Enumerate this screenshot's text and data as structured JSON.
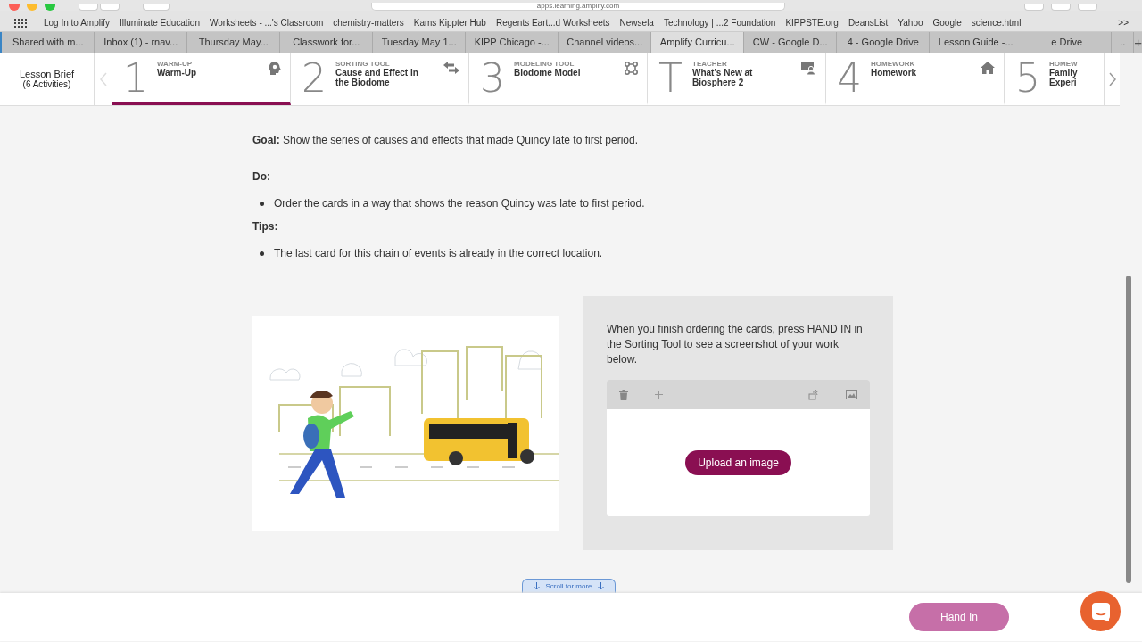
{
  "browser": {
    "address": "apps.learning.amplify.com",
    "bookmarks": [
      "Log In to Amplify",
      "Illuminate Education",
      "Worksheets - ...'s Classroom",
      "chemistry-matters",
      "Kams Kippter Hub",
      "Regents Eart...d Worksheets",
      "Newsela",
      "Technology | ...2 Foundation",
      "KIPPSTE.org",
      "DeansList",
      "Yahoo",
      "Google",
      "science.html"
    ],
    "bookmarks_more": ">>",
    "tabs": [
      {
        "label": "Shared with m...",
        "selected": false
      },
      {
        "label": "Inbox (1) - rnav...",
        "selected": false
      },
      {
        "label": "Thursday May...",
        "selected": false
      },
      {
        "label": "Classwork for...",
        "selected": false
      },
      {
        "label": "Tuesday May 1...",
        "selected": false
      },
      {
        "label": "KIPP Chicago -...",
        "selected": false
      },
      {
        "label": "Channel videos...",
        "selected": false
      },
      {
        "label": "Amplify Curricu...",
        "selected": true
      },
      {
        "label": "CW - Google D...",
        "selected": false
      },
      {
        "label": "4 - Google Drive",
        "selected": false
      },
      {
        "label": "Lesson Guide -...",
        "selected": false
      },
      {
        "label": "e Drive",
        "selected": false
      },
      {
        "label": "..",
        "selected": false
      }
    ],
    "new_tab": "+"
  },
  "lesson_brief": {
    "title": "Lesson Brief",
    "subtitle": "(6 Activities)"
  },
  "activities": [
    {
      "number": "1",
      "kind": "warmup",
      "label": "WARM-UP",
      "title": "Warm-Up",
      "selected": true
    },
    {
      "number": "2",
      "kind": "sorting",
      "label": "SORTING TOOL",
      "title": "Cause and Effect in the Biodome",
      "selected": false
    },
    {
      "number": "3",
      "kind": "modeling",
      "label": "MODELING TOOL",
      "title": "Biodome Model",
      "selected": false
    },
    {
      "number": "T",
      "kind": "teacher",
      "label": "TEACHER",
      "title": "What's New at Biosphere 2",
      "selected": false
    },
    {
      "number": "4",
      "kind": "homework",
      "label": "HOMEWORK",
      "title": "Homework",
      "selected": false
    },
    {
      "number": "5",
      "kind": "family",
      "label": "HOMEW",
      "title": "Family Experi",
      "selected": false
    }
  ],
  "content": {
    "goal_label": "Goal:",
    "goal": "Show the series of causes and effects that made Quincy late to first period.",
    "do_label": "Do:",
    "do_items": [
      "Order the cards in a way that shows the reason Quincy was late to first period."
    ],
    "tips_label": "Tips:",
    "tips_items": [
      "The last card for this chain of events is already in the correct location."
    ],
    "panel": {
      "instructions": "When you finish ordering the cards, press HAND IN in the Sorting Tool to see a screenshot of your work below.",
      "upload_button": "Upload an image"
    },
    "scroll_hint": "Scroll for more"
  },
  "footer": {
    "hand_in": "Hand In"
  }
}
